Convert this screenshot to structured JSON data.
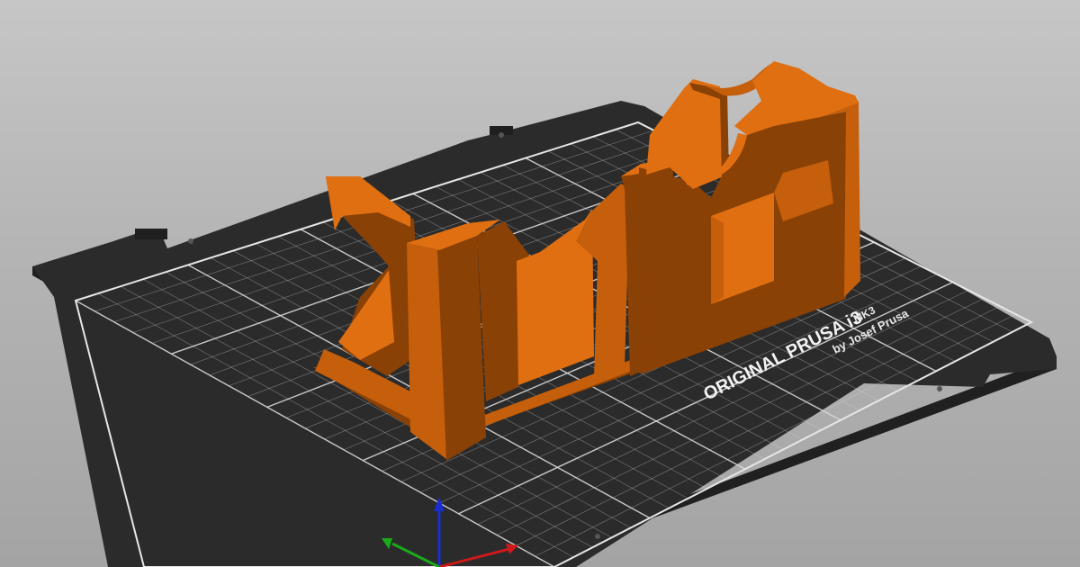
{
  "viewport": {
    "background_top": "#c6c6c6",
    "background_bottom": "#a4a4a4"
  },
  "bed": {
    "brand_text": "ORIGINAL PRUSA i3",
    "model_text": "MK3",
    "maker_text": "by Josef Prusa",
    "plate_color": "#2b2b2b",
    "grid_color": "#d9d9d9"
  },
  "model": {
    "color_light": "#e06f12",
    "color_mid": "#c55f0c",
    "color_dark": "#8a4105"
  },
  "axes": {
    "x_color": "#cc1a1a",
    "y_color": "#1aaa1a",
    "z_color": "#1a2ed0"
  }
}
